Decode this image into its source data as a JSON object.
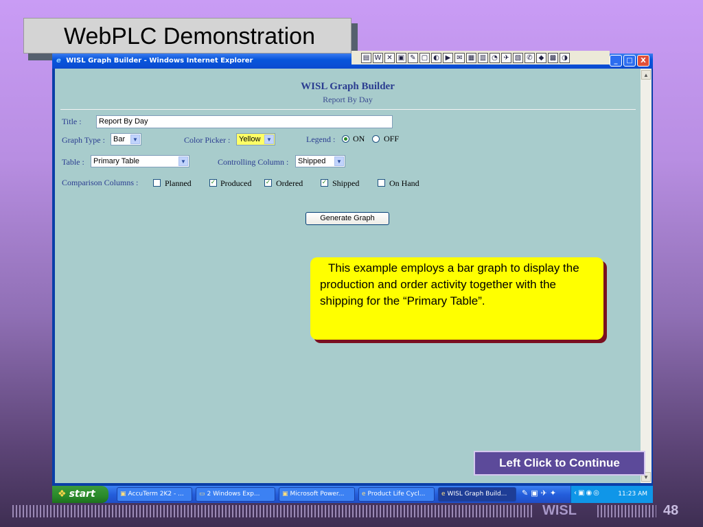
{
  "slide": {
    "title": "WebPLC Demonstration",
    "brand": "WISL",
    "page_number": "48",
    "continue_label": "Left Click to Continue"
  },
  "browser": {
    "window_title": "WISL Graph Builder - Windows Internet Explorer",
    "controls": [
      "_",
      "□",
      "X"
    ]
  },
  "toolbar_icons": [
    "▤",
    "W",
    "✕",
    "▣",
    "✎",
    "▢",
    "◐",
    "▶",
    "✉",
    "▦",
    "▥",
    "◔",
    "✈",
    "▧",
    "✆",
    "◆",
    "▩",
    "◑"
  ],
  "app": {
    "title": "WISL Graph Builder",
    "subtitle": "Report By Day",
    "title_label": "Title :",
    "title_value": "Report By Day",
    "graph_type_label": "Graph Type :",
    "graph_type_value": "Bar",
    "color_picker_label": "Color Picker :",
    "color_picker_value": "Yellow",
    "legend_label": "Legend :",
    "legend_on": "ON",
    "legend_off": "OFF",
    "legend_selected": "ON",
    "table_label": "Table :",
    "table_value": "Primary Table",
    "controlling_label": "Controlling Column :",
    "controlling_value": "Shipped",
    "comparison_label": "Comparison Columns :",
    "comparison_columns": [
      {
        "label": "Planned",
        "checked": false
      },
      {
        "label": "Produced",
        "checked": true
      },
      {
        "label": "Ordered",
        "checked": true
      },
      {
        "label": "Shipped",
        "checked": true
      },
      {
        "label": "On Hand",
        "checked": false
      }
    ],
    "generate_label": "Generate Graph"
  },
  "callout": {
    "text": "This example employs a bar graph to display the production and order activity together with the shipping for the “Primary Table”."
  },
  "taskbar": {
    "start_label": "start",
    "tasks": [
      {
        "label": "AccuTerm 2K2 - ...",
        "icon": "▣",
        "active": false
      },
      {
        "label": "2 Windows Exp...",
        "icon": "▭",
        "active": false
      },
      {
        "label": "Microsoft Power...",
        "icon": "▣",
        "active": false
      },
      {
        "label": "Product Life Cycl...",
        "icon": "e",
        "active": false
      },
      {
        "label": "WISL Graph Build...",
        "icon": "e",
        "active": true
      }
    ],
    "clock": "11:23 AM"
  }
}
